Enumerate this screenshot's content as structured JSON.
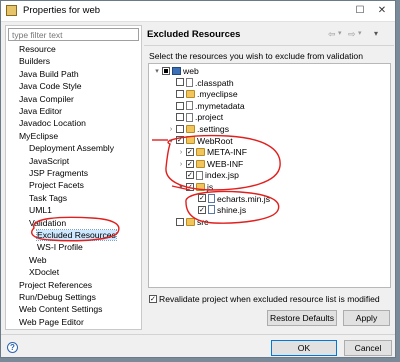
{
  "window": {
    "title": "Properties for web",
    "maximize": "☐",
    "close": "✕"
  },
  "filter": {
    "placeholder": "type filter text"
  },
  "nav": {
    "items": [
      {
        "label": "Resource",
        "level": 0
      },
      {
        "label": "Builders",
        "level": 0
      },
      {
        "label": "Java Build Path",
        "level": 0
      },
      {
        "label": "Java Code Style",
        "level": 0
      },
      {
        "label": "Java Compiler",
        "level": 0
      },
      {
        "label": "Java Editor",
        "level": 0
      },
      {
        "label": "Javadoc Location",
        "level": 0
      },
      {
        "label": "MyEclipse",
        "level": 0
      },
      {
        "label": "Deployment Assembly",
        "level": 1
      },
      {
        "label": "JavaScript",
        "level": 1
      },
      {
        "label": "JSP Fragments",
        "level": 1
      },
      {
        "label": "Project Facets",
        "level": 1
      },
      {
        "label": "Task Tags",
        "level": 1
      },
      {
        "label": "UML1",
        "level": 1
      },
      {
        "label": "Validation",
        "level": 1
      },
      {
        "label": "Excluded Resources",
        "level": 2,
        "selected": true
      },
      {
        "label": "WS-I Profile",
        "level": 2
      },
      {
        "label": "Web",
        "level": 1
      },
      {
        "label": "XDoclet",
        "level": 1
      },
      {
        "label": "Project References",
        "level": 0
      },
      {
        "label": "Run/Debug Settings",
        "level": 0
      },
      {
        "label": "Web Content Settings",
        "level": 0
      },
      {
        "label": "Web Page Editor",
        "level": 0
      }
    ]
  },
  "page": {
    "title": "Excluded Resources",
    "nav_icons": {
      "back": "⇦",
      "back_dropdown": "▾",
      "forward": "⇨",
      "forward_dropdown": "▾",
      "menu": "▾"
    },
    "instruction": "Select the resources you wish to exclude from validation",
    "tree": [
      {
        "label": "web",
        "depth": 0,
        "expander": "▾",
        "check": "partial",
        "icon": "project"
      },
      {
        "label": ".classpath",
        "depth": 1,
        "expander": "",
        "check": "unchecked",
        "icon": "file"
      },
      {
        "label": ".myeclipse",
        "depth": 1,
        "expander": "",
        "check": "unchecked",
        "icon": "folder"
      },
      {
        "label": ".mymetadata",
        "depth": 1,
        "expander": "",
        "check": "unchecked",
        "icon": "file"
      },
      {
        "label": ".project",
        "depth": 1,
        "expander": "",
        "check": "unchecked",
        "icon": "file"
      },
      {
        "label": ".settings",
        "depth": 1,
        "expander": "›",
        "check": "unchecked",
        "icon": "folder"
      },
      {
        "label": "WebRoot",
        "depth": 1,
        "expander": "▾",
        "check": "checked",
        "icon": "folder"
      },
      {
        "label": "META-INF",
        "depth": 2,
        "expander": "›",
        "check": "checked",
        "icon": "folder"
      },
      {
        "label": "WEB-INF",
        "depth": 2,
        "expander": "›",
        "check": "checked",
        "icon": "folder"
      },
      {
        "label": "index.jsp",
        "depth": 2,
        "expander": "",
        "check": "checked",
        "icon": "file"
      },
      {
        "label": "js",
        "depth": 2,
        "expander": "▾",
        "check": "checked",
        "icon": "folder"
      },
      {
        "label": "echarts.min.js",
        "depth": 3,
        "expander": "",
        "check": "checked",
        "icon": "js"
      },
      {
        "label": "shine.js",
        "depth": 3,
        "expander": "",
        "check": "checked",
        "icon": "js"
      },
      {
        "label": "src",
        "depth": 1,
        "expander": "",
        "check": "unchecked",
        "icon": "folder"
      }
    ],
    "revalidate_label": "Revalidate project when excluded resource list is modified",
    "revalidate_checked": true,
    "restore_defaults": "Restore Defaults",
    "apply": "Apply"
  },
  "footer": {
    "help": "?",
    "ok": "OK",
    "cancel": "Cancel"
  },
  "colors": {
    "annotation": "#e0201e",
    "selection": "#cde8ff"
  }
}
